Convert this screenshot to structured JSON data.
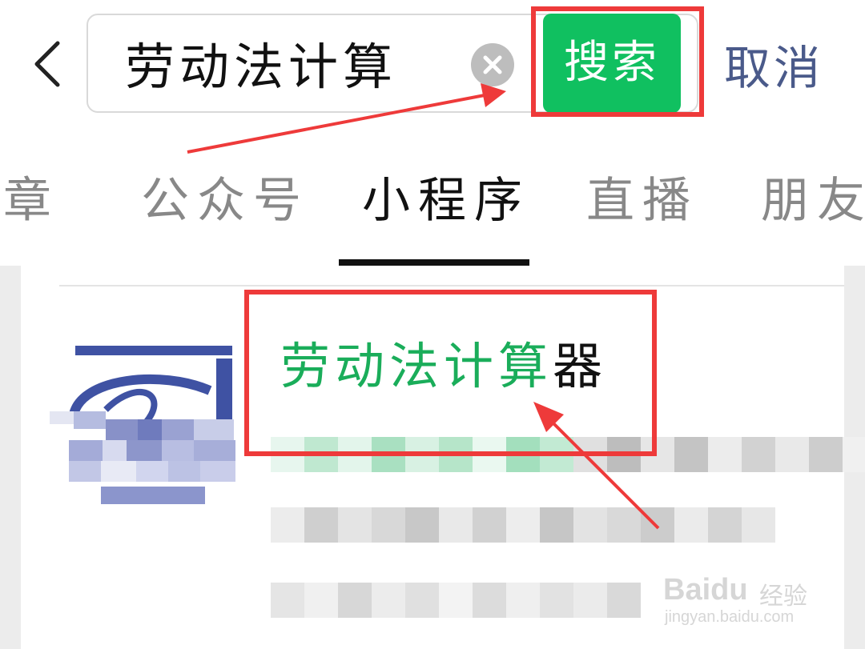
{
  "search": {
    "query": "劳动法计算",
    "search_label": "搜索",
    "cancel_label": "取消"
  },
  "tabs": [
    {
      "label": "文章"
    },
    {
      "label": "公众号"
    },
    {
      "label": "小程序"
    },
    {
      "label": "直播"
    },
    {
      "label": "朋友圈"
    }
  ],
  "active_tab": "小程序",
  "result": {
    "title_highlight": "劳动法计算",
    "title_rest": "器"
  },
  "watermark": {
    "brand": "Bai",
    "brand_suffix": "du",
    "cn": "经验",
    "url": "jingyan.baidu.com"
  },
  "colors": {
    "accent_green": "#10c060",
    "highlight_green": "#1aad5a",
    "cancel_blue": "#4a5a8a",
    "annotation_red": "#ee3a3a"
  }
}
